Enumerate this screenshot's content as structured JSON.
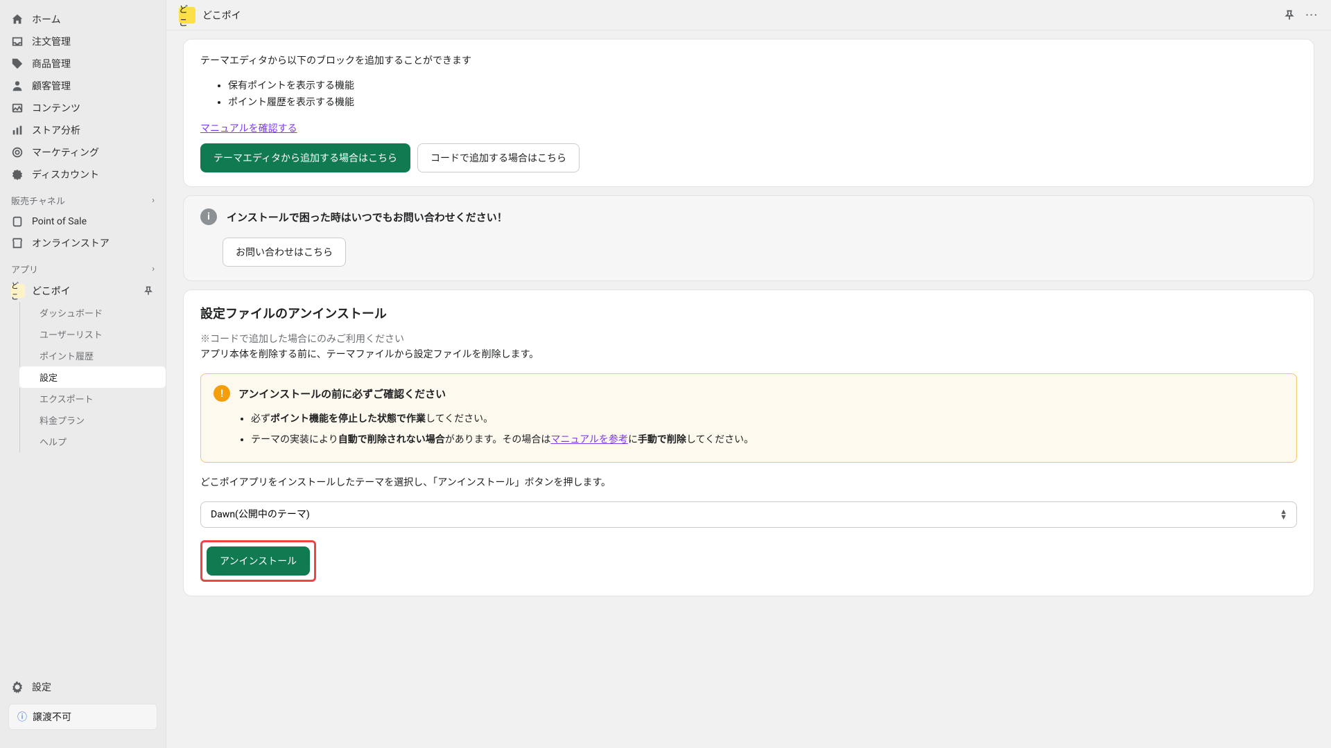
{
  "header": {
    "app_name": "どこポイ"
  },
  "sidebar": {
    "home": "ホーム",
    "orders": "注文管理",
    "products": "商品管理",
    "customers": "顧客管理",
    "content": "コンテンツ",
    "analytics": "ストア分析",
    "marketing": "マーケティング",
    "discounts": "ディスカウント",
    "sales_channels_header": "販売チャネル",
    "pos": "Point of Sale",
    "online_store": "オンラインストア",
    "apps_header": "アプリ",
    "app_name": "どこポイ",
    "submenu": {
      "dashboard": "ダッシュボード",
      "userlist": "ユーザーリスト",
      "point_history": "ポイント履歴",
      "settings": "設定",
      "export": "エクスポート",
      "plan": "料金プラン",
      "help": "ヘルプ"
    },
    "settings_bottom": "設定",
    "non_transferable": "譲渡不可"
  },
  "blocks_section": {
    "intro": "テーマエディタから以下のブロックを追加することができます",
    "feature1": "保有ポイントを表示する機能",
    "feature2": "ポイント履歴を表示する機能",
    "manual_link": "マニュアルを確認する",
    "btn_theme_editor": "テーマエディタから追加する場合はこちら",
    "btn_code": "コードで追加する場合はこちら"
  },
  "contact_section": {
    "title": "インストールで困った時はいつでもお問い合わせください！",
    "btn": "お問い合わせはこちら"
  },
  "uninstall_section": {
    "title": "設定ファイルのアンインストール",
    "note": "※コードで追加した場合にのみご利用ください",
    "desc": "アプリ本体を削除する前に、テーマファイルから設定ファイルを削除します。",
    "warning_title": "アンインストールの前に必ずご確認ください",
    "w1a": "必ず",
    "w1b": "ポイント機能を停止した状態で作業",
    "w1c": "してください。",
    "w2a": "テーマの実装により",
    "w2b": "自動で削除されない場合",
    "w2c": "があります。その場合は",
    "w2d": "マニュアルを参考",
    "w2e": "に",
    "w2f": "手動で削除",
    "w2g": "してください。",
    "instruction": "どこポイアプリをインストールしたテーマを選択し、「アンインストール」ボタンを押します。",
    "selected_theme": "Dawn(公開中のテーマ)",
    "uninstall_btn": "アンインストール"
  }
}
